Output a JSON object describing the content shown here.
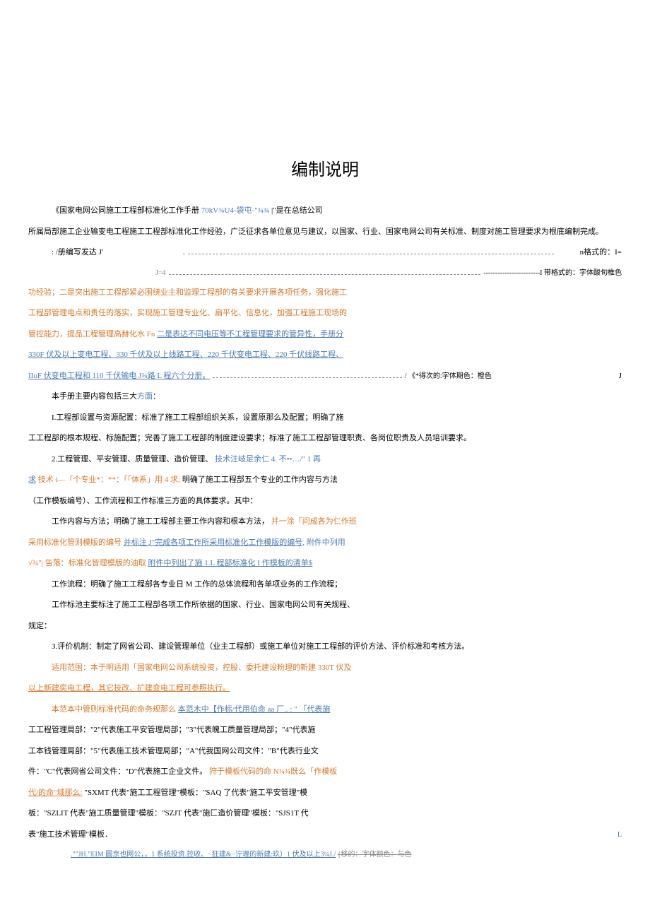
{
  "title": "编制说明",
  "p1": {
    "a": "《国家电网公同施工工程部标准化工作手册 ",
    "b": "70kV¾U4-袋屯-\"¾¾",
    "c": "|\"是在总结公司"
  },
  "p2": "所属局部施工企业输变电工程施工工程部标准化工作经验，广泛征求各单位意见与建议，以国家、行业、国家电网公司有关标准、制度对施工管理要求为根底编制完成。",
  "p3": {
    "a": ": /册编写发达 J'",
    "b": ".",
    "c": "n格式的：I=",
    "d": "J=4",
    "e": "------------------------I 带格式的：字体酸旬椎色"
  },
  "p4": "功经验；二是突出施工工程部紧必围绕业主和监理工程部的有关要求开展各项任务，强化施工",
  "p5": "工程部管理电点和责任的落实，实现施工管理专业化、扁平化、信息化，加强工程施工现场的",
  "p6": {
    "a": "管控能力，提品工程管理高赫化水 Fn",
    "b": "二是表达不同电压等不工程管理要求的管异性，手册分"
  },
  "p7": "330F 伏及以上变电工程、330 千伏及以上线路工程、220 千伏变电工程、220 千伏线路工程、",
  "p8": {
    "a": "IIoF 伏变电工程和 110 千伏输电 J¾路 L 程六个分册。",
    "b": "/ 《*得次的:字体期色：橙色",
    "c": "J"
  },
  "p9": "本手册主要内容包括三大方面：",
  "p10": "I.工程部设置与资源配置：标准了施工工程部组织关系，设置原那么及配置；明确了施",
  "p11": "工工程部的根本规程、标施配置；完善了施工工程部的制度建设要求；标准了施工工程部管理职责、各岗位职贵及人员培训要求。",
  "p12": {
    "a": "2.工程管理、平安管理、质量管理、造价管理、",
    "b": "技术注岐足余仁 4. 不••…/\" 1 再"
  },
  "p13": {
    "a": "求",
    "b": "技术 i—「个专业*：**：「「体系」用 4 求;",
    "c": " 明确了施工工程部五个专业的工作内容与方法"
  },
  "p14": "（工作模板编号）、工作流程和工作标准三方面的具体要求。其中：",
  "p15": {
    "a": "工作内容与方法；明确了施工工程部主要工作内容和根本方法，",
    "b": "并一涂「问成各为仁作班"
  },
  "p16": {
    "a": "采用标准化管则模版的编号",
    "b": "并标注 J\"完成各项工作所采用标准化工作模版的编号,",
    "c": "附件中列用"
  },
  "p17": {
    "a": "√¾\"| 告落：标准化皆理模版的油取",
    "b": "附件中列出了施 1.L 程部标准化 I 作模板的清单$"
  },
  "p18": "工作流程：明确了施工工程部各专业日 M 工作的总体流程和各单项业务的工作流程；",
  "p19": "工作标池主要标注了施工工程部各项工作所依据的国家、行业、国家电网公司有关规程、",
  "p20": "规定：",
  "p21": "3.评价机制：制定了网省公司、建设管理单位（业主工程部）或施工单位对施工工程部的评价方法、评价标准和考核方法。",
  "p22": "适用范围：本于明适用「国家电网公司系统投资，控股、委托建设粉理的新建 330T 伏及",
  "p23": "以上新建奕电工程，其它技改、扩建变电工程可参照执行。",
  "p24": {
    "a": "本范本中管则标准代码的命务规那么",
    "b": "本范木中【作标/代用伯命 aa 厂.. :   \" 「代表施"
  },
  "p25": "工工程管理局部：\"2\"代表施工平安管理局部；\"3\"代表魄工质量管理局部；\"4\"代表施",
  "p26": "工本钱管理局部：\"5\"代表施工技术管理局部；\"A\"代我国网公司文件：\"B\"代表行业文",
  "p27": {
    "a": "件：\"C\"代表网省公司文件：\"D\"代表施工企业文件。",
    "b": "狩于模板代码的命 N¾¾既么「作模板"
  },
  "p28": {
    "a": "代/的命\"域那么:",
    "b": "\"SXMT 代表\"施工工程管理\"模板：\"SAQ 了代表\"施工平安管理\"模"
  },
  "p29": "板：\"SZLIT 代表\"施工质量管理\"模板：\"SZJT 代表\"施匚造价管理\"模板：\"SJS1T 代",
  "p30": {
    "a": "表\"施工技术管理\"模板．",
    "b": "L"
  },
  "p31": {
    "a": ".\"\"JH.\"EIM 圆京也网公，，1 系统投资.控收、−狂建&−泞理的新建:玖）1 伏及以上3¼J./",
    "b": "{移的：字体额色：与色"
  }
}
